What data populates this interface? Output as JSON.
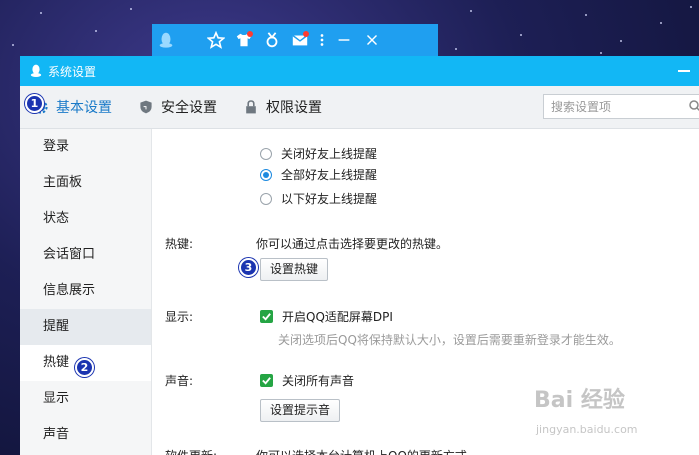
{
  "qq_toolbar": {
    "icons": [
      "qq-penguin-icon",
      "star-icon",
      "shirt-icon",
      "medal-icon",
      "mail-icon",
      "more-icon",
      "minimize-icon",
      "close-icon"
    ]
  },
  "window": {
    "title": "系统设置",
    "accent": "#12b7f5"
  },
  "top_nav": {
    "tabs": [
      {
        "label": "基本设置",
        "icon": "gear-icon",
        "active": true
      },
      {
        "label": "安全设置",
        "icon": "shield-icon",
        "active": false
      },
      {
        "label": "权限设置",
        "icon": "lock-icon",
        "active": false
      }
    ],
    "search_placeholder": "搜索设置项"
  },
  "sidebar": {
    "items": [
      {
        "label": "登录"
      },
      {
        "label": "主面板"
      },
      {
        "label": "状态"
      },
      {
        "label": "会话窗口"
      },
      {
        "label": "信息展示"
      },
      {
        "label": "提醒"
      },
      {
        "label": "热键"
      },
      {
        "label": "显示"
      },
      {
        "label": "声音"
      }
    ],
    "active": "热键"
  },
  "content": {
    "reminder_options": [
      {
        "label": "关闭好友上线提醒",
        "selected": false
      },
      {
        "label": "全部好友上线提醒",
        "selected": true
      },
      {
        "label": "以下好友上线提醒",
        "selected": false
      }
    ],
    "hotkey": {
      "label": "热键:",
      "description": "你可以通过点击选择要更改的热键。",
      "button": "设置热键"
    },
    "display": {
      "label": "显示:",
      "option": "开启QQ适配屏幕DPI",
      "checked": true,
      "hint": "关闭选项后QQ将保持默认大小，设置后需要重新登录才能生效。"
    },
    "sound": {
      "label": "声音:",
      "option": "关闭所有声音",
      "checked": true,
      "button": "设置提示音"
    },
    "software_update": {
      "label": "软件更新:",
      "description": "你可以选择本台计算机上QQ的更新方式"
    }
  },
  "markers": [
    "1",
    "2",
    "3"
  ],
  "watermark": {
    "text": "Bai 经验",
    "url_text": "jingyan.baidu.com"
  }
}
